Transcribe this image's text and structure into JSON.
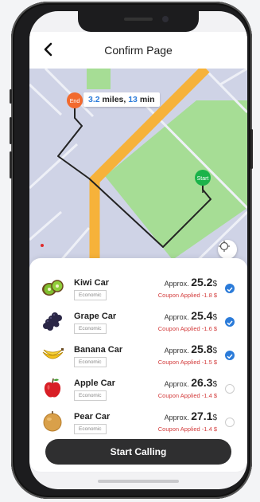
{
  "header": {
    "title": "Confirm Page"
  },
  "map": {
    "distance": "3.2",
    "distance_unit": " miles, ",
    "duration": "13",
    "duration_unit": " min",
    "end_label": "End",
    "start_label": "Start"
  },
  "cars": [
    {
      "name": "Kiwi Car",
      "type": "Economic",
      "approx": "Approx.",
      "price": "25.2",
      "currency": "$",
      "coupon": "Coupon Applied -1.8 $",
      "selected": true,
      "icon": "kiwi-icon"
    },
    {
      "name": "Grape Car",
      "type": "Economic",
      "approx": "Approx.",
      "price": "25.4",
      "currency": "$",
      "coupon": "Coupon Applied -1.6 $",
      "selected": true,
      "icon": "grape-icon"
    },
    {
      "name": "Banana Car",
      "type": "Economic",
      "approx": "Approx.",
      "price": "25.8",
      "currency": "$",
      "coupon": "Coupon Applied -1.5 $",
      "selected": true,
      "icon": "banana-icon"
    },
    {
      "name": "Apple Car",
      "type": "Economic",
      "approx": "Approx.",
      "price": "26.3",
      "currency": "$",
      "coupon": "Coupon Applied -1.4 $",
      "selected": false,
      "icon": "apple-icon"
    },
    {
      "name": "Pear Car",
      "type": "Economic",
      "approx": "Approx.",
      "price": "27.1",
      "currency": "$",
      "coupon": "Coupon Applied -1.4 $",
      "selected": false,
      "icon": "pear-icon"
    }
  ],
  "action": {
    "start_label": "Start Calling"
  },
  "colors": {
    "accent": "#2b7bd9",
    "road": "#f6b23a",
    "park": "#a6dd95",
    "coupon": "#d33c3c",
    "start_pin": "#1bb34a",
    "end_pin": "#f26a2e"
  }
}
